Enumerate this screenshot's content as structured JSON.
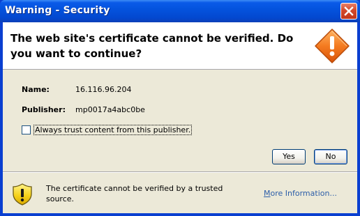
{
  "window": {
    "title": "Warning - Security"
  },
  "header": {
    "message": "The web site's certificate cannot be verified.  Do you want to continue?"
  },
  "fields": {
    "name_label": "Name:",
    "name_value": "16.116.96.204",
    "publisher_label": "Publisher:",
    "publisher_value": "mp0017a4abc0be"
  },
  "trust": {
    "label": "Always trust content from this publisher.",
    "checked": false
  },
  "buttons": {
    "yes": "Yes",
    "no": "No"
  },
  "footer": {
    "message": "The certificate cannot be verified by a trusted source.",
    "more_info_first": "M",
    "more_info_rest": "ore Information..."
  },
  "icons": {
    "close": "close-icon",
    "header_warning": "warning-diamond-icon",
    "footer_warning": "warning-shield-icon"
  },
  "colors": {
    "titlebar": "#0453de",
    "close_button": "#d3482a",
    "dialog_face": "#ece9d8",
    "link": "#2b5da8",
    "warning_orange": "#f47b20"
  }
}
